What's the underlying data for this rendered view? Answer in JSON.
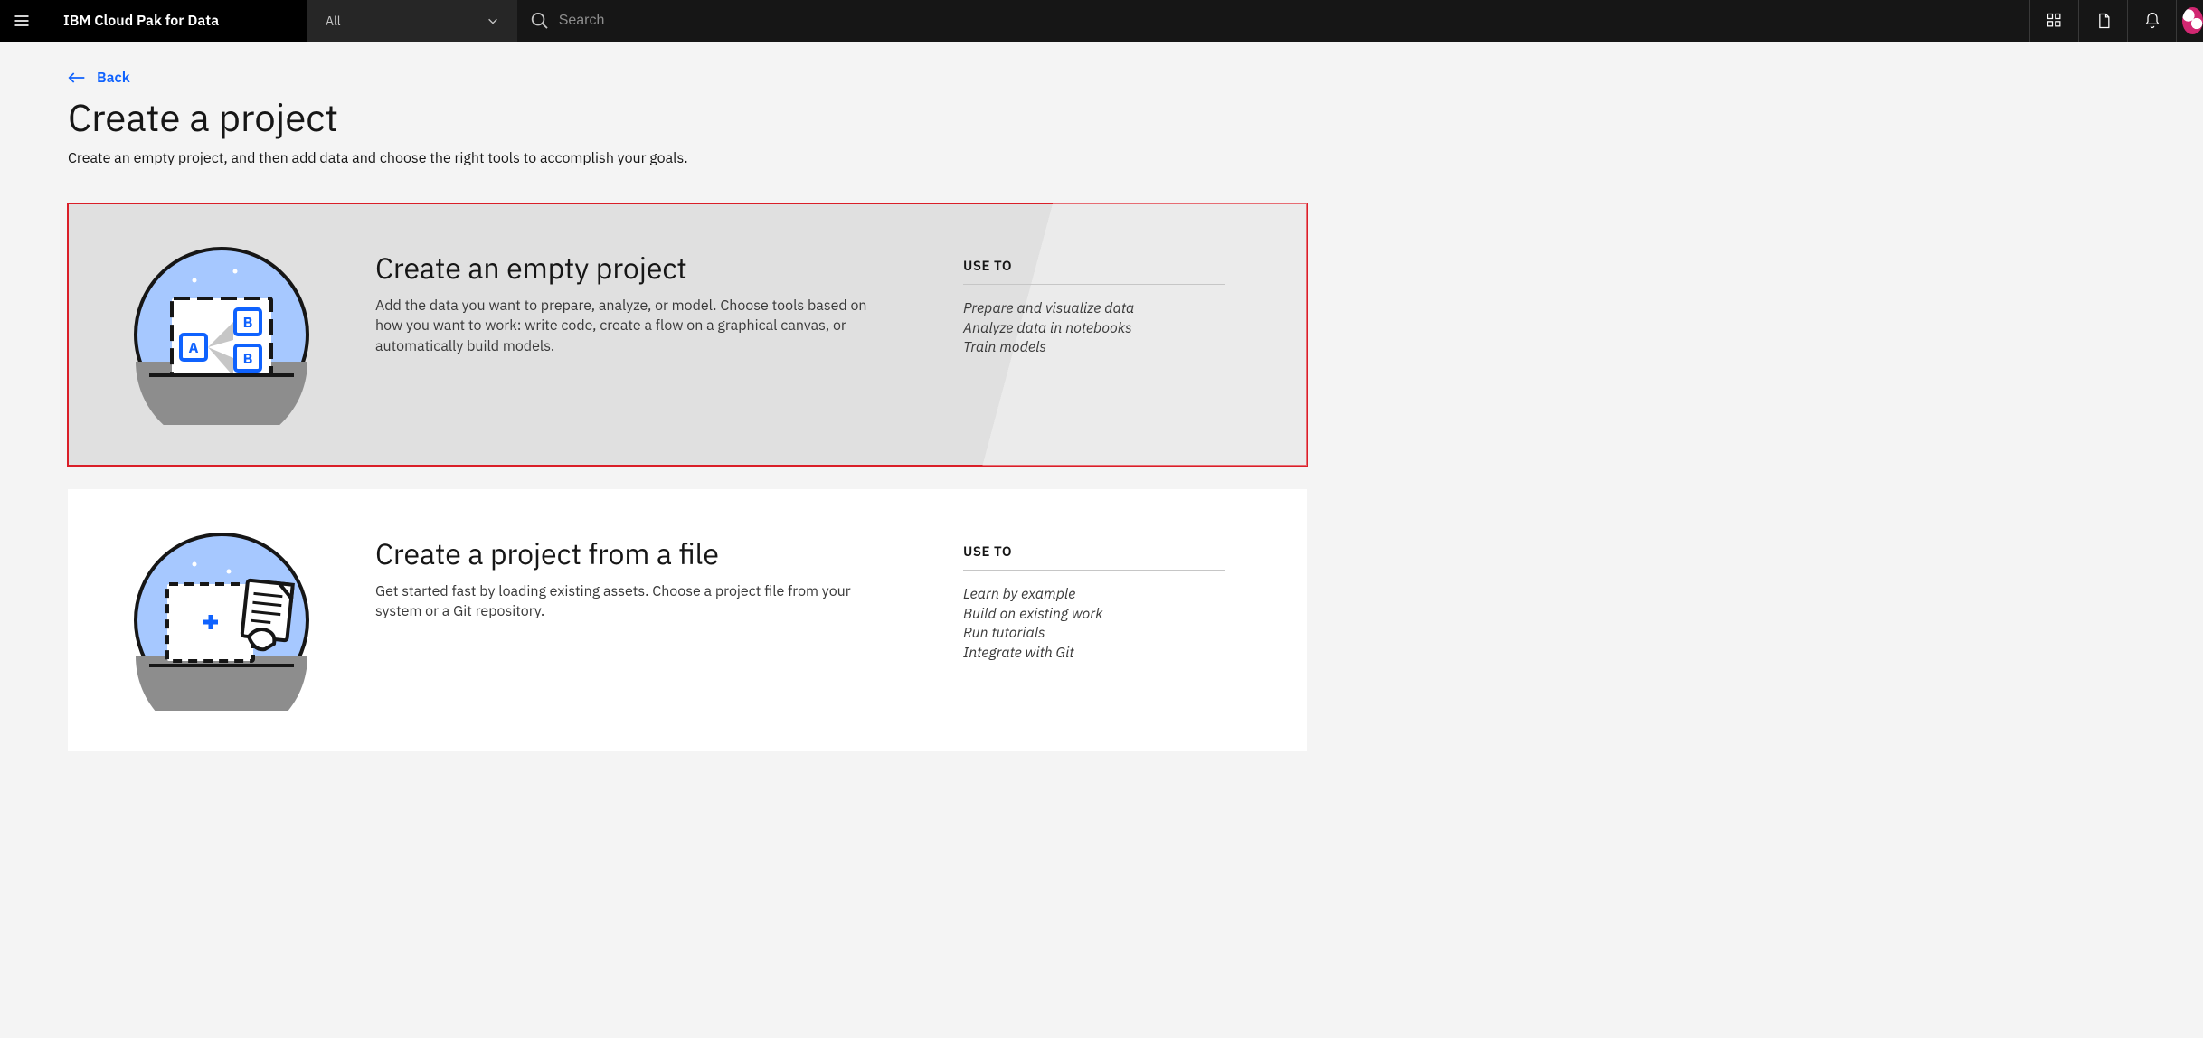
{
  "header": {
    "brand": "IBM Cloud Pak for Data",
    "scope": "All",
    "search_placeholder": "Search",
    "icons": {
      "launcher": "apps-icon",
      "doc": "document-icon",
      "notify": "bell-icon"
    }
  },
  "page": {
    "back_label": "Back",
    "title": "Create a project",
    "subtitle": "Create an empty project, and then add data and choose the right tools to accomplish your goals."
  },
  "uses_label": "USE TO",
  "cards": [
    {
      "title": "Create an empty project",
      "desc": "Add the data you want to prepare, analyze, or model. Choose tools based on how you want to work: write code, create a flow on a graphical canvas, or automatically build models.",
      "uses": [
        "Prepare and visualize data",
        "Analyze data in notebooks",
        "Train models"
      ],
      "selected": true
    },
    {
      "title": "Create a project from a file",
      "desc": "Get started fast by loading existing assets. Choose a project file from your system or a Git repository.",
      "uses": [
        "Learn by example",
        "Build on existing work",
        "Run tutorials",
        "Integrate with Git"
      ],
      "selected": false
    }
  ]
}
